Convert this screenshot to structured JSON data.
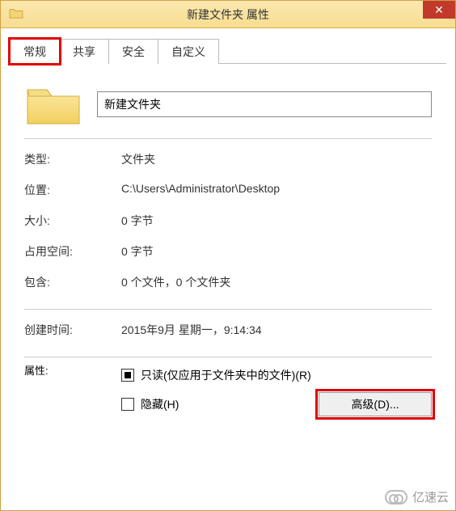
{
  "window": {
    "title": "新建文件夹 属性"
  },
  "tabs": {
    "general": "常规",
    "sharing": "共享",
    "security": "安全",
    "customize": "自定义"
  },
  "general": {
    "name_value": "新建文件夹",
    "type_label": "类型:",
    "type_value": "文件夹",
    "location_label": "位置:",
    "location_value": "C:\\Users\\Administrator\\Desktop",
    "size_label": "大小:",
    "size_value": "0 字节",
    "disk_label": "占用空间:",
    "disk_value": "0 字节",
    "contains_label": "包含:",
    "contains_value": "0 个文件，0 个文件夹",
    "created_label": "创建时间:",
    "created_value": "2015年9月 星期一，9:14:34",
    "attributes_label": "属性:",
    "readonly_label": "只读(仅应用于文件夹中的文件)(R)",
    "hidden_label": "隐藏(H)",
    "advanced_label": "高级(D)..."
  },
  "watermark": {
    "text": "亿速云"
  }
}
